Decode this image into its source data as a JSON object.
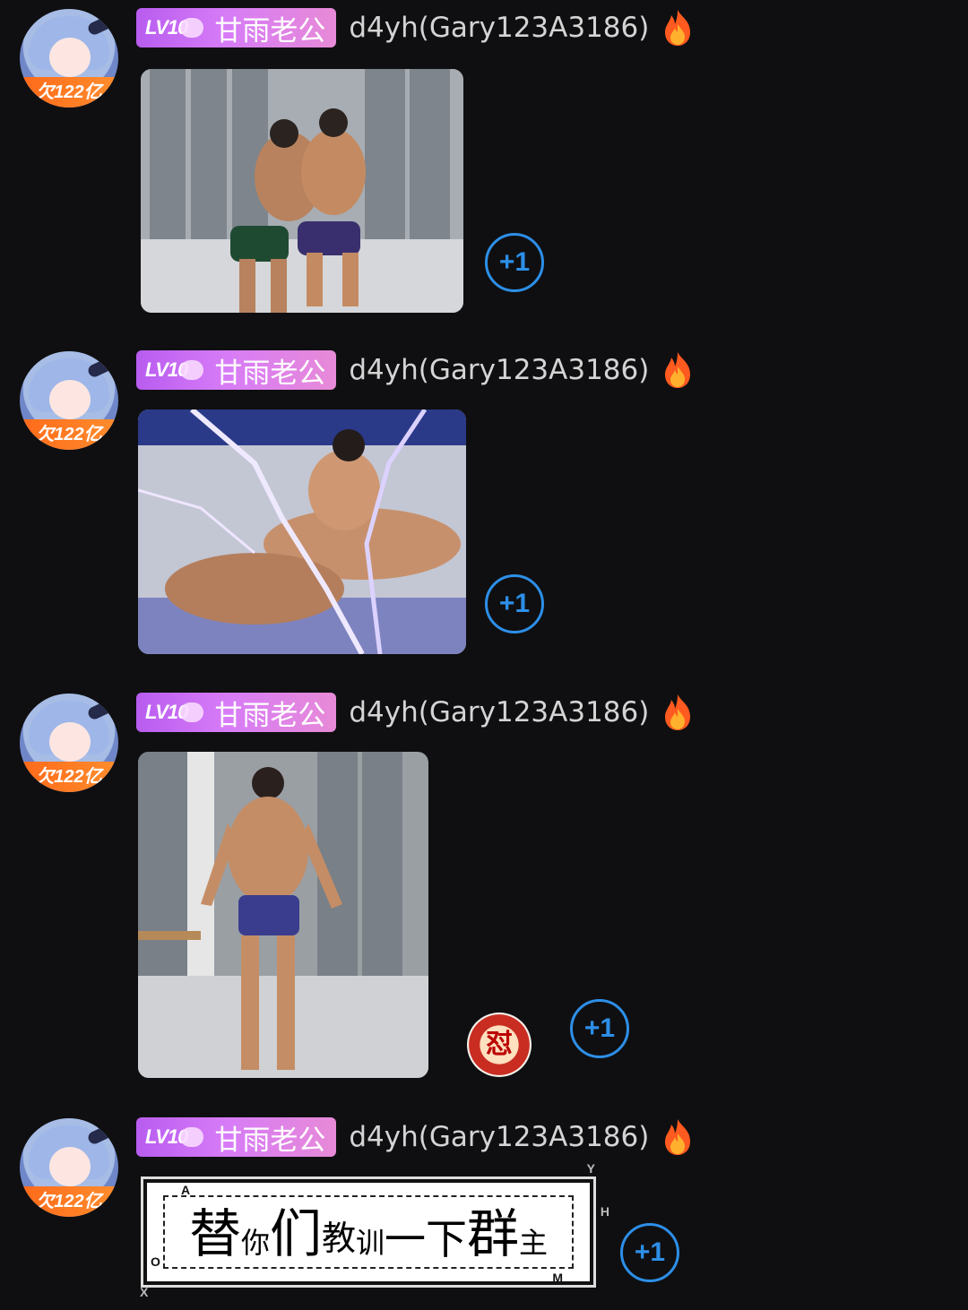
{
  "messages": [
    {
      "avatar": {
        "badge": "欠122亿"
      },
      "tag": {
        "level": "LV10",
        "title": "甘雨老公"
      },
      "username": "d4yh(Gary123A3186)",
      "plus_label": "+1"
    },
    {
      "avatar": {
        "badge": "欠122亿"
      },
      "tag": {
        "level": "LV10",
        "title": "甘雨老公"
      },
      "username": "d4yh(Gary123A3186)",
      "plus_label": "+1"
    },
    {
      "avatar": {
        "badge": "欠122亿"
      },
      "tag": {
        "level": "LV10",
        "title": "甘雨老公"
      },
      "username": "d4yh(Gary123A3186)",
      "reaction_glyph": "怼",
      "plus_label": "+1"
    },
    {
      "avatar": {
        "badge": "欠122亿"
      },
      "tag": {
        "level": "LV10",
        "title": "甘雨老公"
      },
      "username": "d4yh(Gary123A3186)",
      "sticker": {
        "chars": [
          "替",
          "你",
          "们",
          "教",
          "训",
          "一",
          "下",
          "群",
          "主"
        ],
        "corner_marks": [
          "A",
          "Y",
          "H",
          "O",
          "X",
          "M"
        ]
      },
      "plus_label": "+1"
    }
  ],
  "colors": {
    "background": "#0f0f11",
    "tag_gradient_start": "#b85cf0",
    "tag_gradient_end": "#e78ad7",
    "plus_blue": "#2d8fe8",
    "avatar_band": "#ff6a1a"
  },
  "icons": [
    "fire-icon",
    "plus-one-icon",
    "reaction-dui-sticker"
  ]
}
